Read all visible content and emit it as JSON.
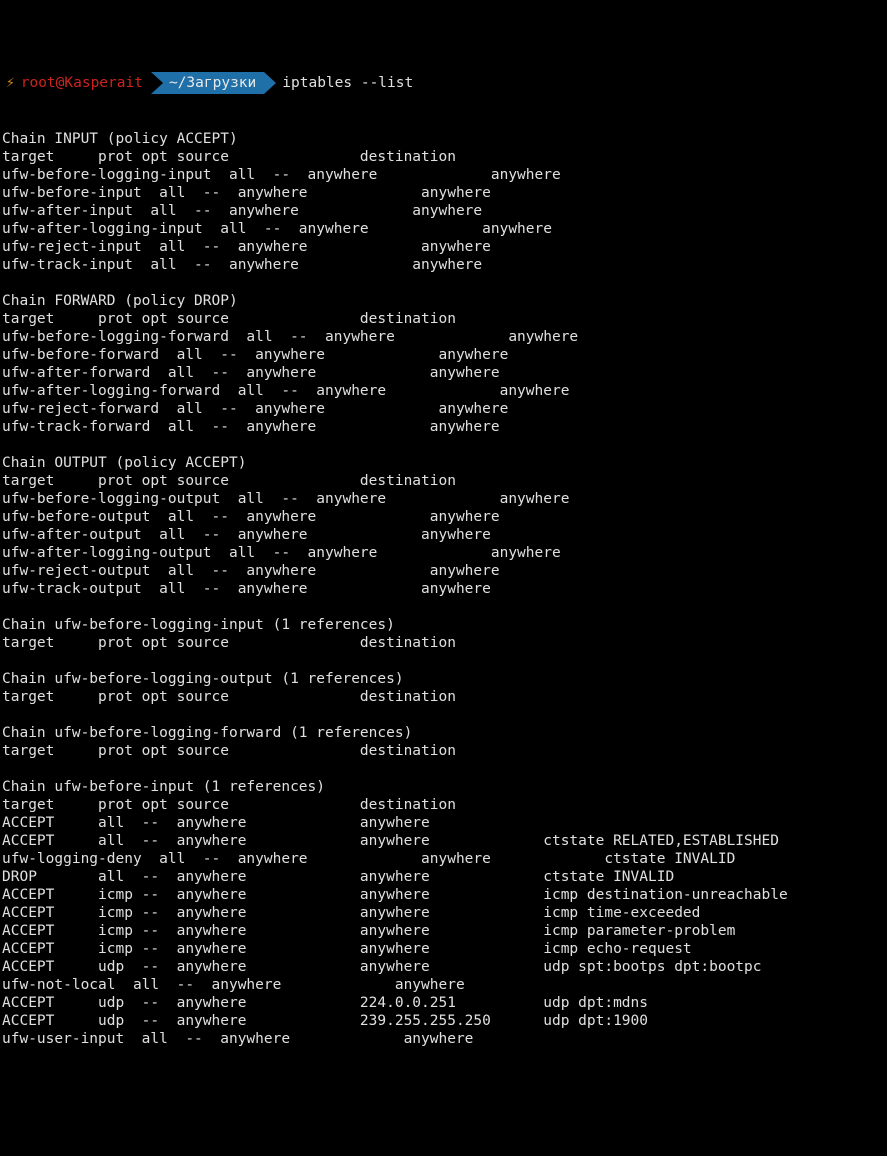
{
  "prompt": {
    "bolt": "⚡",
    "user": "root",
    "at": "@",
    "host": "Kasperait",
    "path": "~/Загрузки",
    "command": "iptables --list"
  },
  "lines": [
    "Chain INPUT (policy ACCEPT)",
    "target     prot opt source               destination         ",
    "ufw-before-logging-input  all  --  anywhere             anywhere            ",
    "ufw-before-input  all  --  anywhere             anywhere            ",
    "ufw-after-input  all  --  anywhere             anywhere            ",
    "ufw-after-logging-input  all  --  anywhere             anywhere            ",
    "ufw-reject-input  all  --  anywhere             anywhere            ",
    "ufw-track-input  all  --  anywhere             anywhere            ",
    "",
    "Chain FORWARD (policy DROP)",
    "target     prot opt source               destination         ",
    "ufw-before-logging-forward  all  --  anywhere             anywhere            ",
    "ufw-before-forward  all  --  anywhere             anywhere            ",
    "ufw-after-forward  all  --  anywhere             anywhere            ",
    "ufw-after-logging-forward  all  --  anywhere             anywhere            ",
    "ufw-reject-forward  all  --  anywhere             anywhere            ",
    "ufw-track-forward  all  --  anywhere             anywhere            ",
    "",
    "Chain OUTPUT (policy ACCEPT)",
    "target     prot opt source               destination         ",
    "ufw-before-logging-output  all  --  anywhere             anywhere            ",
    "ufw-before-output  all  --  anywhere             anywhere            ",
    "ufw-after-output  all  --  anywhere             anywhere            ",
    "ufw-after-logging-output  all  --  anywhere             anywhere            ",
    "ufw-reject-output  all  --  anywhere             anywhere            ",
    "ufw-track-output  all  --  anywhere             anywhere            ",
    "",
    "Chain ufw-before-logging-input (1 references)",
    "target     prot opt source               destination         ",
    "",
    "Chain ufw-before-logging-output (1 references)",
    "target     prot opt source               destination         ",
    "",
    "Chain ufw-before-logging-forward (1 references)",
    "target     prot opt source               destination         ",
    "",
    "Chain ufw-before-input (1 references)",
    "target     prot opt source               destination         ",
    "ACCEPT     all  --  anywhere             anywhere            ",
    "ACCEPT     all  --  anywhere             anywhere             ctstate RELATED,ESTABLISHED",
    "ufw-logging-deny  all  --  anywhere             anywhere             ctstate INVALID",
    "DROP       all  --  anywhere             anywhere             ctstate INVALID",
    "ACCEPT     icmp --  anywhere             anywhere             icmp destination-unreachable",
    "ACCEPT     icmp --  anywhere             anywhere             icmp time-exceeded",
    "ACCEPT     icmp --  anywhere             anywhere             icmp parameter-problem",
    "ACCEPT     icmp --  anywhere             anywhere             icmp echo-request",
    "ACCEPT     udp  --  anywhere             anywhere             udp spt:bootps dpt:bootpc",
    "ufw-not-local  all  --  anywhere             anywhere            ",
    "ACCEPT     udp  --  anywhere             224.0.0.251          udp dpt:mdns",
    "ACCEPT     udp  --  anywhere             239.255.255.250      udp dpt:1900",
    "ufw-user-input  all  --  anywhere             anywhere            ",
    ""
  ]
}
